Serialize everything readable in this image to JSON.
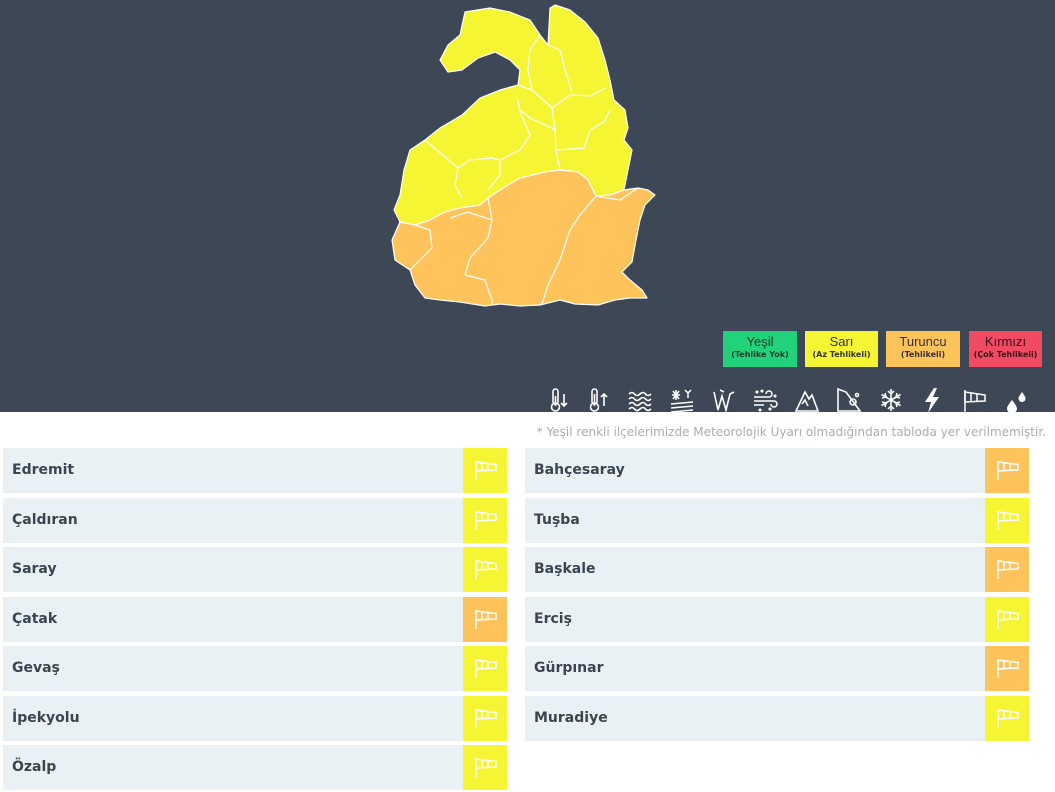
{
  "colors": {
    "background_top": "#3d4756",
    "green": "#22d27b",
    "yellow": "#f5f534",
    "orange": "#ffc35c",
    "red": "#f04b63",
    "row_bg": "#eaf1f5"
  },
  "legend": [
    {
      "label": "Yeşil",
      "sub": "(Tehlike Yok)"
    },
    {
      "label": "Sarı",
      "sub": "(Az Tehlikeli)"
    },
    {
      "label": "Turuncu",
      "sub": "(Tehlikeli)"
    },
    {
      "label": "Kırmızı",
      "sub": "(Çok Tehlikeli)"
    }
  ],
  "hazard_icons": [
    "cold-temperature-icon",
    "hot-temperature-icon",
    "fog-icon",
    "frost-icon",
    "avalanche-icon",
    "dust-storm-icon",
    "snow-melt-avalanche-icon",
    "landslide-icon",
    "snow-icon",
    "lightning-icon",
    "wind-icon",
    "rain-icon"
  ],
  "note": "* Yeşil renkli ilçelerimizde Meteorolojik Uyarı olmadığından tabloda yer verilmemiştir.",
  "districts": {
    "left": [
      {
        "name": "Edremit",
        "level": "yellow",
        "icon": "wind-icon"
      },
      {
        "name": "Çaldıran",
        "level": "yellow",
        "icon": "wind-icon"
      },
      {
        "name": "Saray",
        "level": "yellow",
        "icon": "wind-icon"
      },
      {
        "name": "Çatak",
        "level": "orange",
        "icon": "wind-icon"
      },
      {
        "name": "Gevaş",
        "level": "yellow",
        "icon": "wind-icon"
      },
      {
        "name": "İpekyolu",
        "level": "yellow",
        "icon": "wind-icon"
      },
      {
        "name": "Özalp",
        "level": "yellow",
        "icon": "wind-icon"
      }
    ],
    "right": [
      {
        "name": "Bahçesaray",
        "level": "orange",
        "icon": "wind-icon"
      },
      {
        "name": "Tuşba",
        "level": "yellow",
        "icon": "wind-icon"
      },
      {
        "name": "Başkale",
        "level": "orange",
        "icon": "wind-icon"
      },
      {
        "name": "Erciş",
        "level": "yellow",
        "icon": "wind-icon"
      },
      {
        "name": "Gürpınar",
        "level": "orange",
        "icon": "wind-icon"
      },
      {
        "name": "Muradiye",
        "level": "yellow",
        "icon": "wind-icon"
      }
    ]
  }
}
